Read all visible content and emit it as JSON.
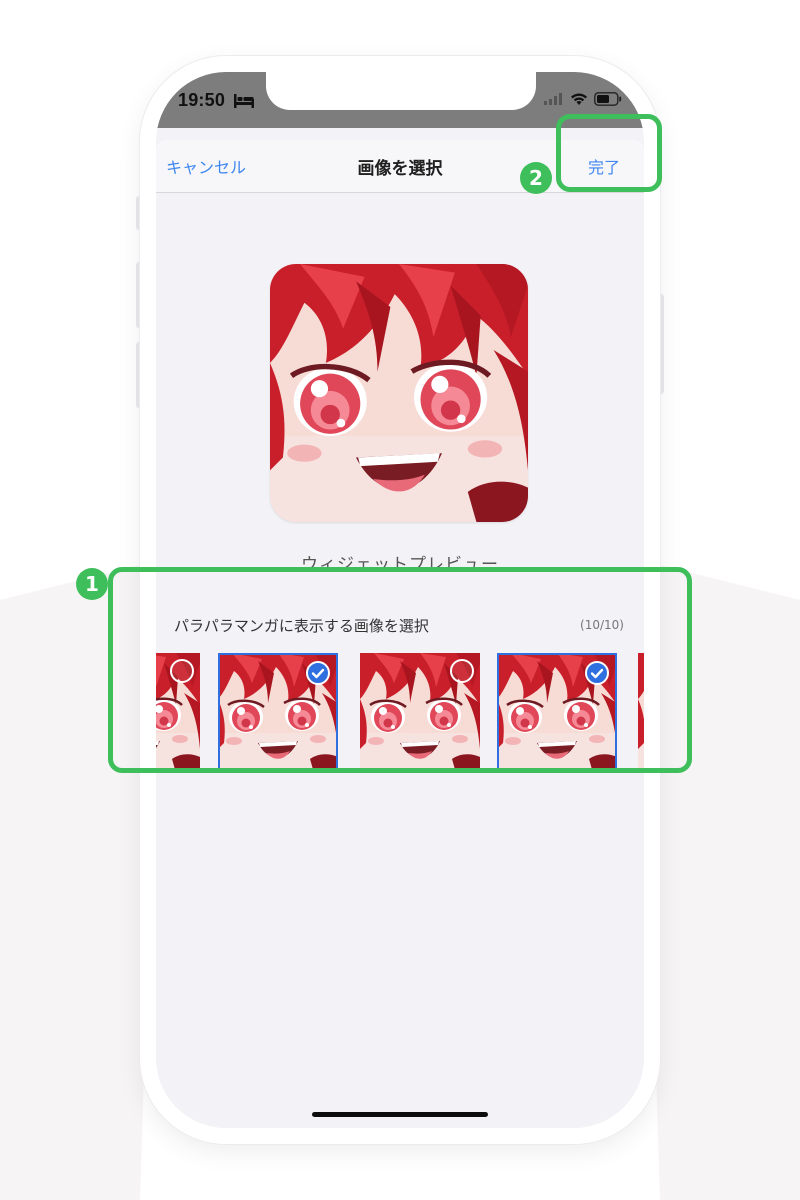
{
  "status_bar": {
    "time": "19:50",
    "icons": [
      "bed-icon",
      "signal-icon",
      "wifi-icon",
      "battery-icon"
    ]
  },
  "nav": {
    "cancel_label": "キャンセル",
    "title": "画像を選択",
    "done_label": "完了"
  },
  "preview": {
    "caption": "ウィジェットプレビュー"
  },
  "selection": {
    "label": "パラパラマンガに表示する画像を選択",
    "count": "(10/10)",
    "thumbnails": [
      {
        "selected": false
      },
      {
        "selected": true
      },
      {
        "selected": false
      },
      {
        "selected": true
      },
      {
        "selected": false
      }
    ]
  },
  "annotations": {
    "badge_1": "1",
    "badge_2": "2",
    "color": "#3fbf5b"
  },
  "colors": {
    "accent": "#3f86f0",
    "selected_border": "#2f6fe0",
    "status_bar": "#7d7d7d",
    "sheet_bg": "#f2f2f7"
  }
}
